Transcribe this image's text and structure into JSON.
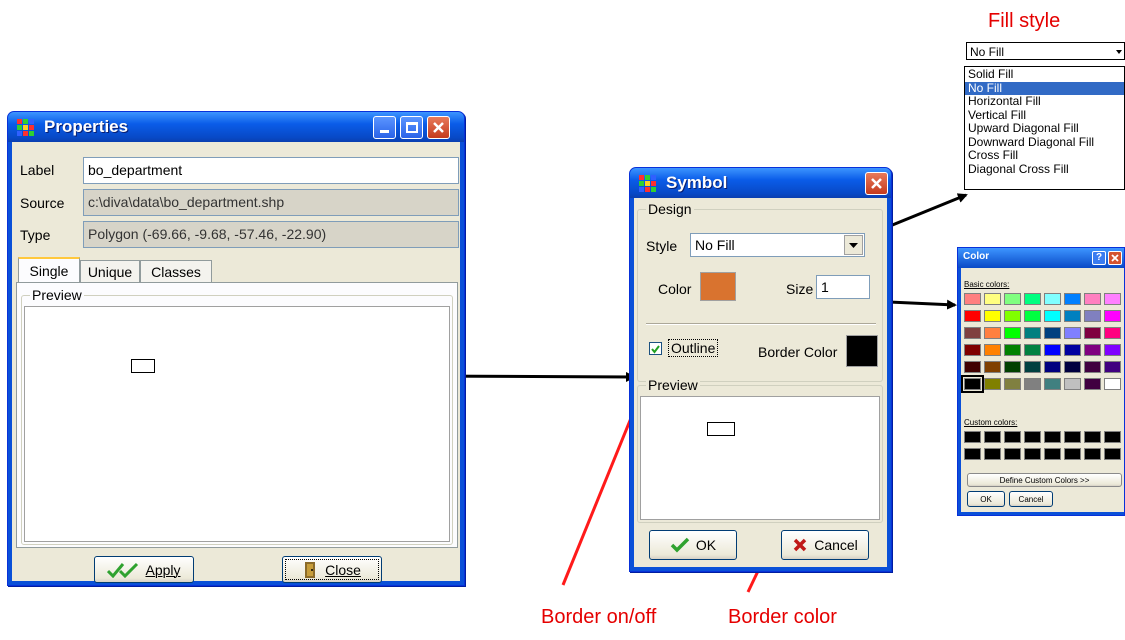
{
  "annotations": {
    "fill_style": "Fill style",
    "border_on_off": "Border on/off",
    "border_color": "Border color"
  },
  "properties": {
    "title": "Properties",
    "label_caption": "Label",
    "label_value": "bo_department",
    "source_caption": "Source",
    "source_value": "c:\\diva\\data\\bo_department.shp",
    "type_caption": "Type",
    "type_value": "Polygon  (-69.66, -9.68, -57.46, -22.90)",
    "tabs": [
      "Single",
      "Unique",
      "Classes"
    ],
    "preview_label": "Preview",
    "apply_label": "Apply",
    "close_label": "Close"
  },
  "symbol": {
    "title": "Symbol",
    "design_label": "Design",
    "style_caption": "Style",
    "style_value": "No Fill",
    "color_caption": "Color",
    "fill_color": "#d9732f",
    "size_caption": "Size",
    "size_value": "1",
    "outline_label": "Outline",
    "outline_checked": true,
    "border_color_caption": "Border Color",
    "border_color": "#000000",
    "preview_label": "Preview",
    "ok_label": "OK",
    "cancel_label": "Cancel"
  },
  "fill_dropdown": {
    "selected": "No Fill",
    "options": [
      "Solid Fill",
      "No Fill",
      "Horizontal Fill",
      "Vertical Fill",
      "Upward Diagonal Fill",
      "Downward Diagonal Fill",
      "Cross Fill",
      "Diagonal Cross Fill"
    ]
  },
  "color_dialog": {
    "title": "Color",
    "basic_colors_label": "Basic colors:",
    "custom_colors_label": "Custom colors:",
    "define_label": "Define Custom Colors >>",
    "ok_label": "OK",
    "cancel_label": "Cancel",
    "basic_colors": [
      [
        "#ff8080",
        "#ffff80",
        "#80ff80",
        "#00ff80",
        "#80ffff",
        "#0080ff",
        "#ff80c0",
        "#ff80ff"
      ],
      [
        "#ff0000",
        "#ffff00",
        "#80ff00",
        "#00ff40",
        "#00ffff",
        "#0080c0",
        "#8080c0",
        "#ff00ff"
      ],
      [
        "#804040",
        "#ff8040",
        "#00ff00",
        "#008080",
        "#004080",
        "#8080ff",
        "#800040",
        "#ff0080"
      ],
      [
        "#800000",
        "#ff8000",
        "#008000",
        "#008040",
        "#0000ff",
        "#0000a0",
        "#800080",
        "#8000ff"
      ],
      [
        "#400000",
        "#804000",
        "#004000",
        "#004040",
        "#000080",
        "#000040",
        "#400040",
        "#400080"
      ],
      [
        "#000000",
        "#808000",
        "#808040",
        "#808080",
        "#408080",
        "#c0c0c0",
        "#400040",
        "#ffffff"
      ]
    ]
  }
}
